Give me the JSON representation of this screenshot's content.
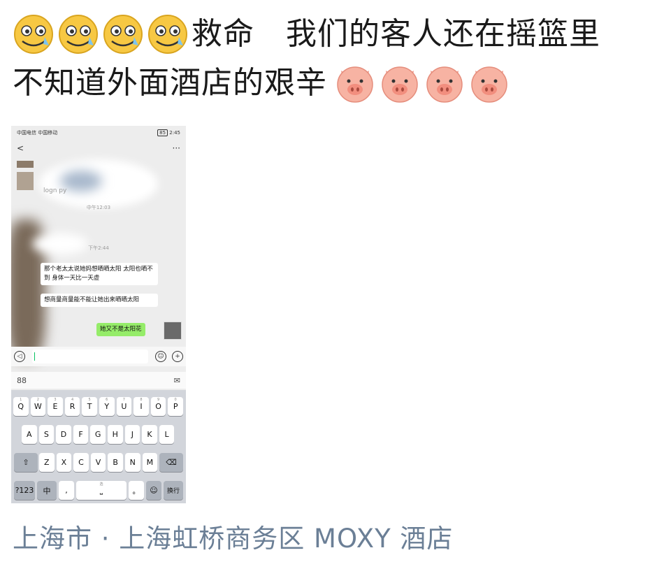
{
  "post": {
    "line1": "救命   我们的客人还在摇篮里",
    "line2": "不知道外面酒店的艰辛",
    "emoji_prefix": "grinning-crying-emoji",
    "emoji_suffix": "pig-face-emoji"
  },
  "screenshot": {
    "status_left": "中国电信 中国移动",
    "status_right": "2:45",
    "battery": "85",
    "title_back": "<",
    "title_more": "···",
    "obscured_text": "logn py",
    "time1": "中午12:03",
    "time2": "下午2:44",
    "msg1": "那个老太太说她妈想晒晒太阳 太阳也晒不到 身体一天比一天虚",
    "msg2": "想商量商量能不能让她出来晒晒太阳",
    "msg3": "她又不是太阳花",
    "kb_toolbar_left": "88",
    "kb_toolbar_right": "✉"
  },
  "keyboard": {
    "row1": [
      "Q",
      "W",
      "E",
      "R",
      "T",
      "Y",
      "U",
      "I",
      "O",
      "P"
    ],
    "row1_sub": [
      "1",
      "2",
      "3",
      "4",
      "5",
      "6",
      "7",
      "8",
      "9",
      "0"
    ],
    "row2": [
      "A",
      "S",
      "D",
      "F",
      "G",
      "H",
      "J",
      "K",
      "L"
    ],
    "row3": [
      "Z",
      "X",
      "C",
      "V",
      "B",
      "N",
      "M"
    ],
    "shift": "⇧",
    "delete": "⌫",
    "num": "?123",
    "lang": "中",
    "comma": ",",
    "space_hint": "选",
    "period": "。",
    "emoji": "☺",
    "enter": "换行"
  },
  "location": {
    "text": "上海市 · 上海虹桥商务区 MOXY 酒店"
  },
  "colors": {
    "location": "#6b7f96",
    "bubble_green": "#95ec69",
    "keyboard_bg": "#d2d5db"
  }
}
